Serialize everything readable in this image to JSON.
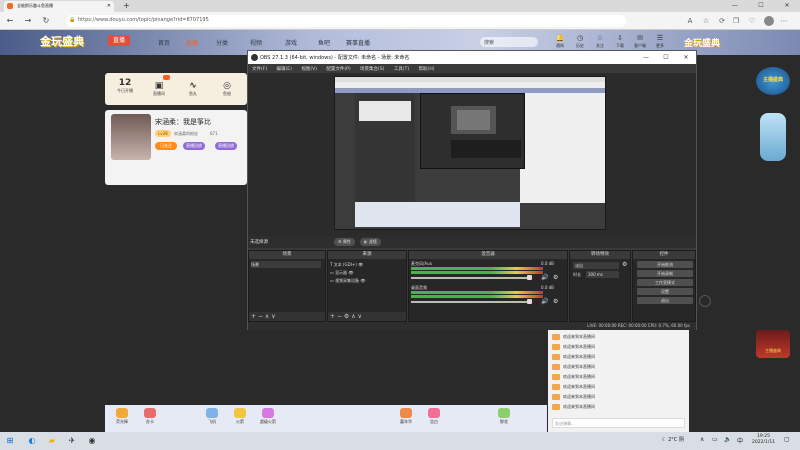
{
  "browser": {
    "tab_title": "全能斯乐趣斗鱼直播",
    "new_tab": "+",
    "url": "https://www.douyu.com/topic/pinange?rid=8707195",
    "window_controls": [
      "—",
      "☐",
      "✕"
    ]
  },
  "site": {
    "logo": "金玩盛典",
    "logo_badge": "直播",
    "nav": [
      "首页",
      "直播",
      "分类",
      "视频",
      "游戏",
      "鱼吧",
      "赛事直播"
    ],
    "nav_active_index": 1,
    "search_placeholder": "搜索",
    "header_icons": [
      {
        "icon": "bell-icon",
        "label": "通知"
      },
      {
        "icon": "history-icon",
        "label": "历史"
      },
      {
        "icon": "star-icon",
        "label": "关注"
      },
      {
        "icon": "download-icon",
        "label": "下载"
      },
      {
        "icon": "message-icon",
        "label": "客户端"
      },
      {
        "icon": "menu-icon",
        "label": "更多"
      }
    ],
    "header_deco": "金玩盛典",
    "stats": [
      {
        "value": "12",
        "label": "今日开播"
      },
      {
        "value": "",
        "label": "直播间"
      },
      {
        "value": "",
        "label": "鱼丸"
      },
      {
        "value": "",
        "label": "鱼翅"
      }
    ],
    "anchor": {
      "name": "宋涵柔：我是筝比",
      "level": "Lv28",
      "tag": "宋涵柔的粉丝",
      "hot": "871",
      "follow": "已关注",
      "tags": [
        "直播回放",
        "直播回放"
      ]
    },
    "chat_lines": [
      "欢迎来到本直播间",
      "欢迎来到本直播间",
      "欢迎来到本直播间",
      "欢迎来到本直播间",
      "欢迎来到本直播间",
      "欢迎来到本直播间",
      "欢迎来到本直播间",
      "欢迎来到本直播间"
    ],
    "chat_placeholder": "发送弹幕...",
    "gifts": [
      "荧光棒",
      "办卡",
      "飞机",
      "火箭",
      "超级火箭",
      "嘉年华",
      "告白",
      "鲜花"
    ],
    "sticker_top": "主播盛典",
    "sticker_bottom": "主播盛典"
  },
  "obs": {
    "title": "OBS 27.1.3 (64-bit, windows) - 配置文件: 未命名 - 场景: 未命名",
    "menu": [
      "文件(F)",
      "编辑(E)",
      "视图(V)",
      "配置文件(P)",
      "场景集合(S)",
      "工具(T)",
      "帮助(H)"
    ],
    "scene_info": "未选择源",
    "scene_buttons": [
      "属性",
      "滤镜"
    ],
    "docks": {
      "scenes": {
        "title": "场景",
        "items": [
          "场景"
        ]
      },
      "sources": {
        "title": "来源",
        "items": [
          "文本 (GDI+)",
          "显示器",
          "视频采集设备"
        ]
      },
      "mixer": {
        "title": "混音器",
        "channels": [
          {
            "name": "麦克风/Aux",
            "db": "0.0 dB"
          },
          {
            "name": "桌面音频",
            "db": "0.0 dB"
          }
        ]
      },
      "transitions": {
        "title": "转场特效",
        "type": "淡出",
        "duration_label": "时长",
        "duration": "300 ms"
      },
      "controls": {
        "title": "控件",
        "buttons": [
          "开始推流",
          "开始录制",
          "工作室模式",
          "设置",
          "退出"
        ]
      }
    },
    "status": "LIVE: 00:00:00   REC: 00:00:00   CPU: 0.7%, 60.00 fps"
  },
  "taskbar": {
    "weather": "2°C 阴",
    "time": "19:25",
    "date": "2022/1/11"
  }
}
